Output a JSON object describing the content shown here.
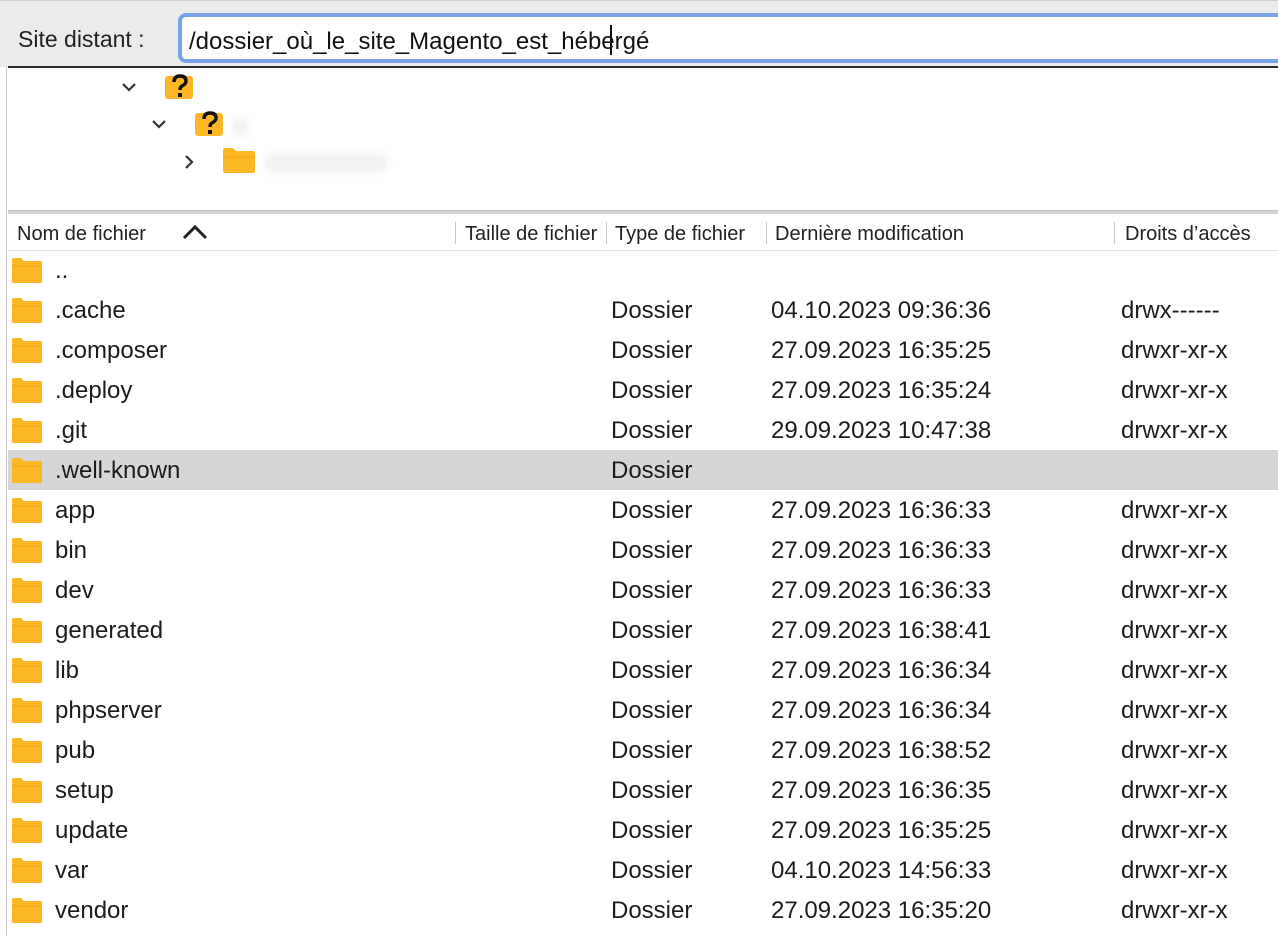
{
  "path_bar": {
    "label": "Site distant :",
    "value": "/dossier_où_le_site_Magento_est_hébergé"
  },
  "tree": [
    {
      "icon": "unknown-folder-icon",
      "expanded": true
    },
    {
      "icon": "unknown-folder-icon",
      "expanded": true
    },
    {
      "icon": "folder-icon",
      "expanded": false
    }
  ],
  "columns": {
    "name": "Nom de fichier",
    "size": "Taille de fichier",
    "type": "Type de fichier",
    "modified": "Dernière modification",
    "permissions": "Droits d’accès"
  },
  "sort": {
    "column": "name",
    "direction": "ascending"
  },
  "files": [
    {
      "name": "..",
      "type": "",
      "modified": "",
      "permissions": ""
    },
    {
      "name": ".cache",
      "type": "Dossier",
      "modified": "04.10.2023 09:36:36",
      "permissions": "drwx------"
    },
    {
      "name": ".composer",
      "type": "Dossier",
      "modified": "27.09.2023 16:35:25",
      "permissions": "drwxr-xr-x"
    },
    {
      "name": ".deploy",
      "type": "Dossier",
      "modified": "27.09.2023 16:35:24",
      "permissions": "drwxr-xr-x"
    },
    {
      "name": ".git",
      "type": "Dossier",
      "modified": "29.09.2023 10:47:38",
      "permissions": "drwxr-xr-x"
    },
    {
      "name": ".well-known",
      "type": "Dossier",
      "modified": "",
      "permissions": "",
      "selected": true
    },
    {
      "name": "app",
      "type": "Dossier",
      "modified": "27.09.2023 16:36:33",
      "permissions": "drwxr-xr-x"
    },
    {
      "name": "bin",
      "type": "Dossier",
      "modified": "27.09.2023 16:36:33",
      "permissions": "drwxr-xr-x"
    },
    {
      "name": "dev",
      "type": "Dossier",
      "modified": "27.09.2023 16:36:33",
      "permissions": "drwxr-xr-x"
    },
    {
      "name": "generated",
      "type": "Dossier",
      "modified": "27.09.2023 16:38:41",
      "permissions": "drwxr-xr-x"
    },
    {
      "name": "lib",
      "type": "Dossier",
      "modified": "27.09.2023 16:36:34",
      "permissions": "drwxr-xr-x"
    },
    {
      "name": "phpserver",
      "type": "Dossier",
      "modified": "27.09.2023 16:36:34",
      "permissions": "drwxr-xr-x"
    },
    {
      "name": "pub",
      "type": "Dossier",
      "modified": "27.09.2023 16:38:52",
      "permissions": "drwxr-xr-x"
    },
    {
      "name": "setup",
      "type": "Dossier",
      "modified": "27.09.2023 16:36:35",
      "permissions": "drwxr-xr-x"
    },
    {
      "name": "update",
      "type": "Dossier",
      "modified": "27.09.2023 16:35:25",
      "permissions": "drwxr-xr-x"
    },
    {
      "name": "var",
      "type": "Dossier",
      "modified": "04.10.2023 14:56:33",
      "permissions": "drwxr-xr-x"
    },
    {
      "name": "vendor",
      "type": "Dossier",
      "modified": "27.09.2023 16:35:20",
      "permissions": "drwxr-xr-x"
    }
  ],
  "colors": {
    "folder": "#fbb824",
    "selection": "#d6d6d6",
    "focus_ring": "#7aa2ec"
  }
}
